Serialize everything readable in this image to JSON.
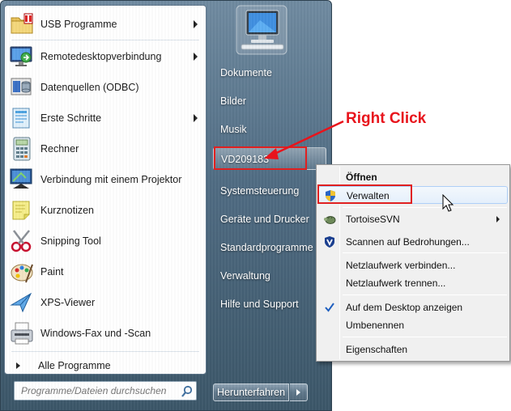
{
  "programs": [
    {
      "label": "USB Programme",
      "icon": "usb-folder-icon",
      "has_submenu": true
    },
    {
      "label": "Remotedesktopverbindung",
      "icon": "remote-desktop-icon",
      "has_submenu": true
    },
    {
      "label": "Datenquellen (ODBC)",
      "icon": "odbc-datasource-icon",
      "has_submenu": false
    },
    {
      "label": "Erste Schritte",
      "icon": "getting-started-icon",
      "has_submenu": true
    },
    {
      "label": "Rechner",
      "icon": "calculator-icon",
      "has_submenu": false
    },
    {
      "label": "Verbindung mit einem Projektor",
      "icon": "projector-icon",
      "has_submenu": false
    },
    {
      "label": "Kurznotizen",
      "icon": "sticky-notes-icon",
      "has_submenu": false
    },
    {
      "label": "Snipping Tool",
      "icon": "scissors-icon",
      "has_submenu": false
    },
    {
      "label": "Paint",
      "icon": "paint-palette-icon",
      "has_submenu": false
    },
    {
      "label": "XPS-Viewer",
      "icon": "xps-viewer-icon",
      "has_submenu": false
    },
    {
      "label": "Windows-Fax und -Scan",
      "icon": "fax-icon",
      "has_submenu": false
    }
  ],
  "all_programs": "Alle Programme",
  "search": {
    "placeholder": "Programme/Dateien durchsuchen"
  },
  "right_links": [
    {
      "label": "Dokumente",
      "has_submenu": false
    },
    {
      "label": "Bilder",
      "has_submenu": false
    },
    {
      "label": "Musik",
      "has_submenu": false
    },
    {
      "label": "VD209183",
      "has_submenu": false
    },
    {
      "label": "Systemsteuerung",
      "has_submenu": false
    },
    {
      "label": "Geräte und Drucker",
      "has_submenu": false
    },
    {
      "label": "Standardprogramme",
      "has_submenu": false
    },
    {
      "label": "Verwaltung",
      "has_submenu": true
    },
    {
      "label": "Hilfe und Support",
      "has_submenu": false
    }
  ],
  "shutdown": {
    "label": "Herunterfahren"
  },
  "context_menu": {
    "items": [
      {
        "label": "Öffnen",
        "bold": true
      },
      {
        "label": "Verwalten",
        "icon": "uac-shield-icon",
        "hovered": true
      },
      {
        "label": "TortoiseSVN",
        "icon": "tortoisesvn-icon",
        "has_submenu": true
      },
      {
        "label": "Scannen auf Bedrohungen...",
        "icon": "security-shield-icon"
      },
      {
        "label": "Netzlaufwerk verbinden..."
      },
      {
        "label": "Netzlaufwerk trennen..."
      },
      {
        "label": "Auf dem Desktop anzeigen",
        "checked": true
      },
      {
        "label": "Umbenennen"
      },
      {
        "label": "Eigenschaften"
      }
    ]
  },
  "annotation": {
    "text": "Right Click",
    "color": "#e8141c"
  }
}
